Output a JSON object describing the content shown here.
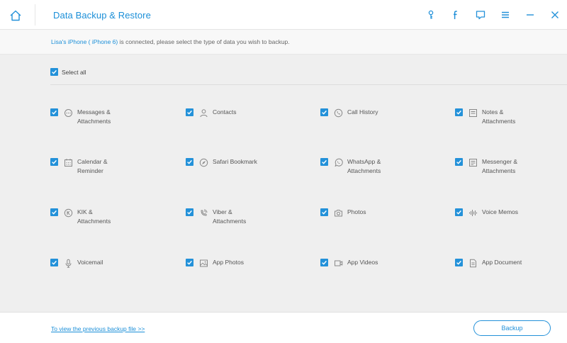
{
  "app": {
    "title": "Data Backup & Restore"
  },
  "titlebar_icons": [
    "key-icon",
    "facebook-icon",
    "feedback-icon",
    "menu-icon",
    "minimize-icon",
    "close-icon"
  ],
  "info": {
    "device": "Lisa's iPhone ( iPhone 6)",
    "message": " is connected, please select the type of data you wish to backup."
  },
  "select_all": {
    "label": "Select all",
    "checked": true
  },
  "items": [
    {
      "label": "Messages & Attachments",
      "icon": "message-icon",
      "checked": true
    },
    {
      "label": "Contacts",
      "icon": "contact-icon",
      "checked": true
    },
    {
      "label": "Call History",
      "icon": "phone-icon",
      "checked": true
    },
    {
      "label": "Notes & Attachments",
      "icon": "notes-icon",
      "checked": true
    },
    {
      "label": "Calendar & Reminder",
      "icon": "calendar-icon",
      "checked": true
    },
    {
      "label": "Safari Bookmark",
      "icon": "compass-icon",
      "checked": true
    },
    {
      "label": "WhatsApp & Attachments",
      "icon": "whatsapp-icon",
      "checked": true
    },
    {
      "label": "Messenger & Attachments",
      "icon": "messenger-icon",
      "checked": true
    },
    {
      "label": "KIK & Attachments",
      "icon": "kik-icon",
      "checked": true
    },
    {
      "label": "Viber & Attachments",
      "icon": "viber-icon",
      "checked": true
    },
    {
      "label": "Photos",
      "icon": "camera-icon",
      "checked": true
    },
    {
      "label": "Voice Memos",
      "icon": "waveform-icon",
      "checked": true
    },
    {
      "label": "Voicemail",
      "icon": "microphone-icon",
      "checked": true
    },
    {
      "label": "App Photos",
      "icon": "image-icon",
      "checked": true
    },
    {
      "label": "App Videos",
      "icon": "video-icon",
      "checked": true
    },
    {
      "label": "App Document",
      "icon": "document-icon",
      "checked": true
    }
  ],
  "footer": {
    "link": "To view the previous backup file >>",
    "button": "Backup"
  },
  "colors": {
    "accent": "#2391d9",
    "title": "#1b8fd8",
    "content_bg": "#efefef"
  }
}
